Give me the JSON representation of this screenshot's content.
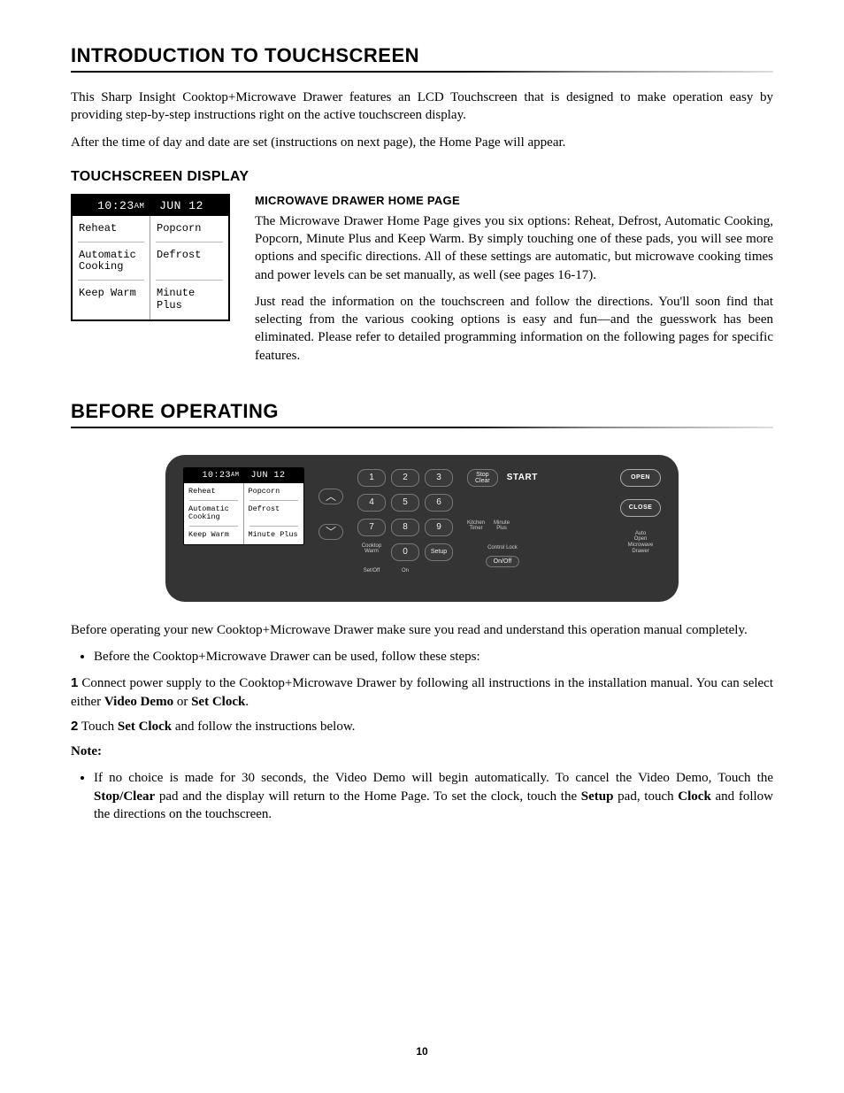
{
  "headings": {
    "intro": "Introduction to Touchscreen",
    "touchscreen_display": "Touchscreen Display",
    "microwave_home": "Microwave Drawer Home Page",
    "before_operating": "Before Operating"
  },
  "intro_paragraphs": [
    "This Sharp Insight Cooktop+Microwave Drawer features an LCD Touchscreen that is designed to make operation easy by providing step-by-step instructions right on the active touchscreen display.",
    "After the time of day and date are set (instructions on next page), the Home Page will appear."
  ],
  "screen": {
    "time": "10:23",
    "ampm": "AM",
    "date": "JUN 12",
    "options": {
      "r0c0": "Reheat",
      "r0c1": "Popcorn",
      "r1c0": "Automatic\nCooking",
      "r1c1": "Defrost",
      "r2c0": "Keep Warm",
      "r2c1": "Minute Plus"
    }
  },
  "home_paragraphs": [
    "The Microwave Drawer Home Page gives you six options: Reheat, Defrost, Automatic Cooking, Popcorn, Minute Plus and Keep Warm. By simply touching one of these pads, you will see more options and specific directions. All of these settings are automatic, but microwave cooking times and power levels can be set manually, as well (see pages 16-17).",
    "Just read the information on the touchscreen and follow the directions. You'll soon find that selecting from the various cooking options is easy and fun—and the guesswork has been eliminated. Please refer to detailed programming information on the following pages for specific features."
  ],
  "panel": {
    "keys": [
      "1",
      "2",
      "3",
      "4",
      "5",
      "6",
      "7",
      "8",
      "9",
      "0"
    ],
    "key_labels": {
      "cooktop_warm": "Cooktop\nWarm",
      "set_off": "Set/Off",
      "on": "On",
      "setup": "Setup"
    },
    "stop_clear": "Stop\nClear",
    "start": "START",
    "kitchen_timer": "Kitchen\nTimer",
    "minute_plus": "Minute\nPlus",
    "control_lock": "Control Lock",
    "on_off": "On/Off",
    "open": "OPEN",
    "close": "CLOSE",
    "auto_open": "Auto\nOpen\nMicrowave\nDrawer"
  },
  "before": {
    "intro": "Before operating your new Cooktop+Microwave Drawer make sure you read and understand this operation manual completely.",
    "bullet1": "Before the Cooktop+Microwave Drawer can be used, follow these steps:",
    "step1_pre": "Connect power supply to the Cooktop+Microwave Drawer by following all instructions in the installation manual. You can select either ",
    "step1_b1": "Video Demo",
    "step1_mid": " or ",
    "step1_b2": "Set Clock",
    "step1_post": ".",
    "step2_pre": "Touch ",
    "step2_b": "Set Clock",
    "step2_post": " and follow the instructions below.",
    "note_label": "Note:",
    "note_pre": "If no choice is made for 30 seconds, the Video Demo will begin automatically. To cancel the Video Demo, Touch the ",
    "note_b1": "Stop/Clear",
    "note_mid1": " pad and the display will return to the Home Page. To set the clock, touch the ",
    "note_b2": "Setup",
    "note_mid2": " pad, touch ",
    "note_b3": "Clock",
    "note_post": " and follow the directions on the touchscreen."
  },
  "page_number": "10"
}
